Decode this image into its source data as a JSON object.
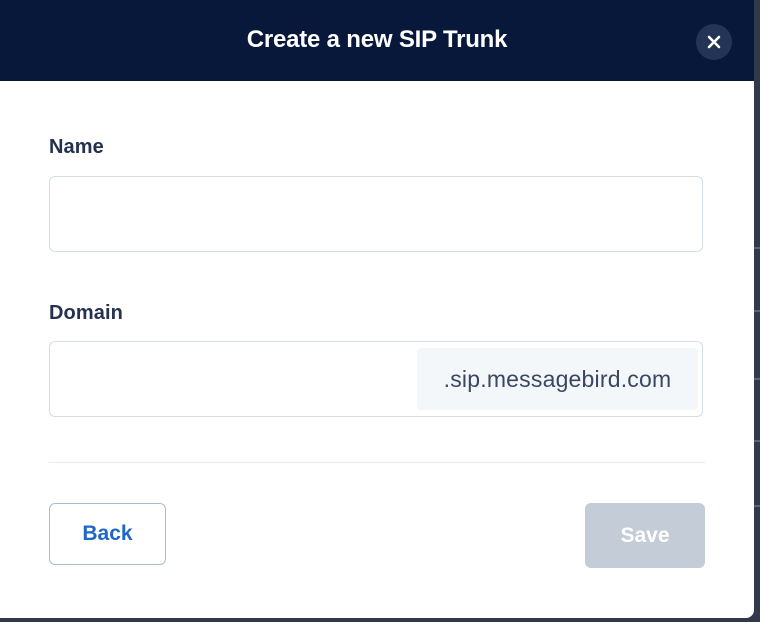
{
  "dialog": {
    "title": "Create a new SIP Trunk",
    "close_icon": "close-icon"
  },
  "form": {
    "name": {
      "label": "Name",
      "value": "",
      "placeholder": ""
    },
    "domain": {
      "label": "Domain",
      "value": "",
      "placeholder": "",
      "suffix": ".sip.messagebird.com"
    }
  },
  "footer": {
    "back_label": "Back",
    "save_label": "Save",
    "save_disabled": true
  },
  "colors": {
    "header_bg": "#08183b",
    "primary_link": "#1f66c6",
    "disabled_button": "#c4ccd8"
  }
}
